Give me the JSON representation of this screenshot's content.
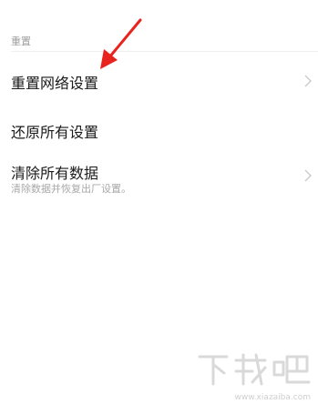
{
  "section": {
    "header": "重置"
  },
  "items": [
    {
      "title": "重置网络设置",
      "has_chevron": true
    },
    {
      "title": "还原所有设置",
      "has_chevron": false
    },
    {
      "title": "清除所有数据",
      "subtitle": "清除数据并恢复出厂设置。",
      "has_chevron": true
    }
  ],
  "annotation": {
    "icon": "red-arrow-icon",
    "color": "#e8231d"
  },
  "watermark": {
    "logo_text": "下载吧",
    "url": "www.xiazaiba.com"
  },
  "colors": {
    "background": "#ffffff",
    "title_text": "#1a1a1a",
    "secondary_text": "#a8a8a8",
    "chevron": "#c8c8c8"
  }
}
